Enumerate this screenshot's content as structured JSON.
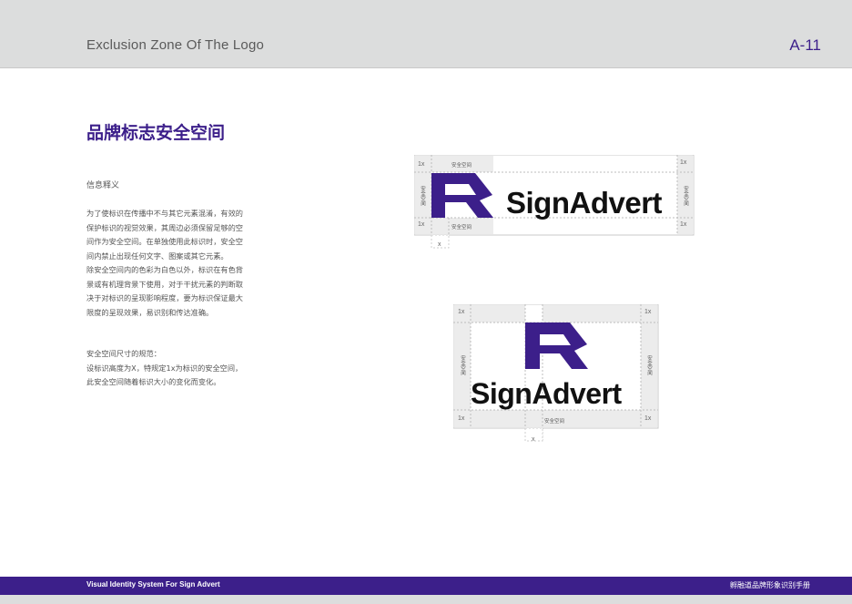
{
  "header": {
    "title": "Exclusion Zone Of The Logo",
    "page_number": "A-11"
  },
  "section": {
    "title": "品牌标志安全空间"
  },
  "info": {
    "heading": "信息释义",
    "paragraph1": [
      "为了使标识在传播中不与其它元素混淆，有效的",
      "保护标识的视觉效果，其周边必须保留足够的空",
      "间作为安全空间。在单独使用此标识时，安全空",
      "间内禁止出现任何文字、图案或其它元素。",
      "除安全空间内的色彩为白色以外，标识在有色背",
      "景或有机理背景下使用，对于干扰元素的判断取",
      "决于对标识的呈现影响程度，要为标识保证最大",
      "限度的呈现效果，易识别和传达准确。"
    ],
    "paragraph2": [
      "安全空间尺寸的规范：",
      "设标识高度为X，特规定1x为标识的安全空间，",
      "此安全空间随着标识大小的变化而变化。"
    ]
  },
  "diagram": {
    "unit_label": "1x",
    "x_label": "x",
    "zone_label": "安全空间",
    "wordmark": "SignAdvert"
  },
  "footer": {
    "left": "Visual Identity System For Sign Advert",
    "right": "孵融道品牌形象识别手册"
  },
  "colors": {
    "brand": "#3c1f8a",
    "zone": "#ececec",
    "header_bg": "#dcdddd"
  }
}
